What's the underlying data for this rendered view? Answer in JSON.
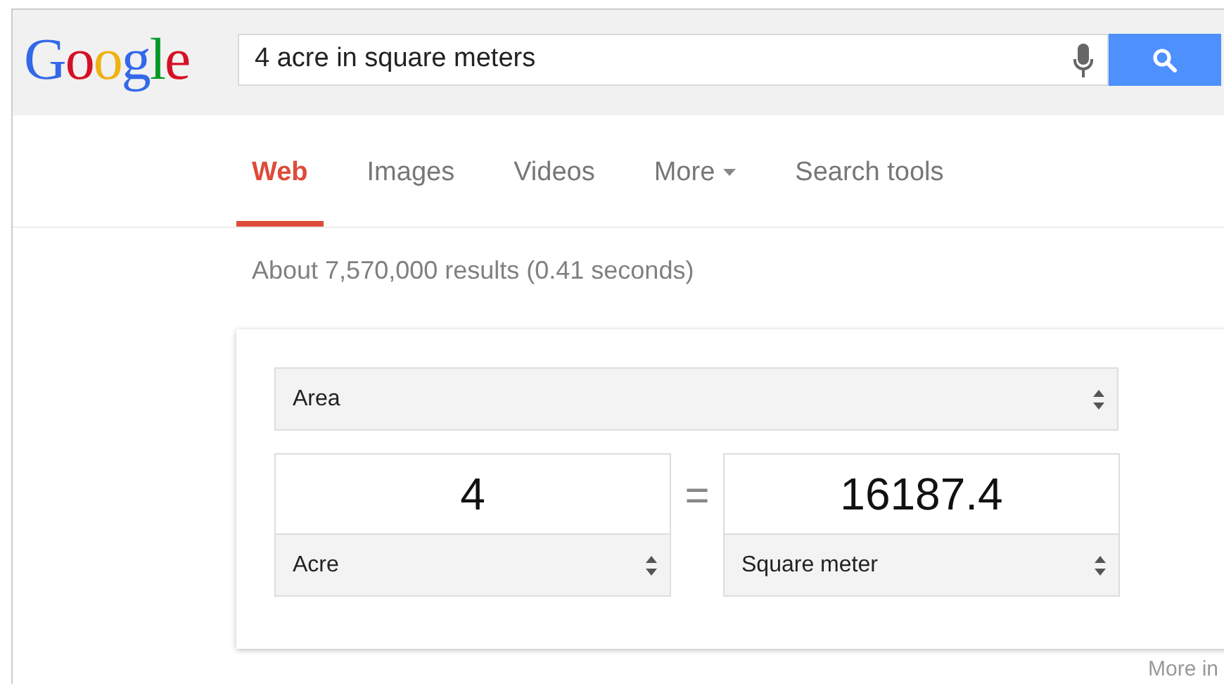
{
  "logo": "Google",
  "search": {
    "value": "4 acre in square meters"
  },
  "tabs": [
    {
      "label": "Web",
      "selected": true,
      "dropdown": false
    },
    {
      "label": "Images",
      "selected": false,
      "dropdown": false
    },
    {
      "label": "Videos",
      "selected": false,
      "dropdown": false
    },
    {
      "label": "More",
      "selected": false,
      "dropdown": true
    },
    {
      "label": "Search tools",
      "selected": false,
      "dropdown": false
    }
  ],
  "result_stats": "About 7,570,000 results (0.41 seconds)",
  "converter": {
    "quantity": "Area",
    "equals": "=",
    "from": {
      "value": "4",
      "unit": "Acre"
    },
    "to": {
      "value": "16187.4",
      "unit": "Square meter"
    }
  },
  "more_info": "More in"
}
